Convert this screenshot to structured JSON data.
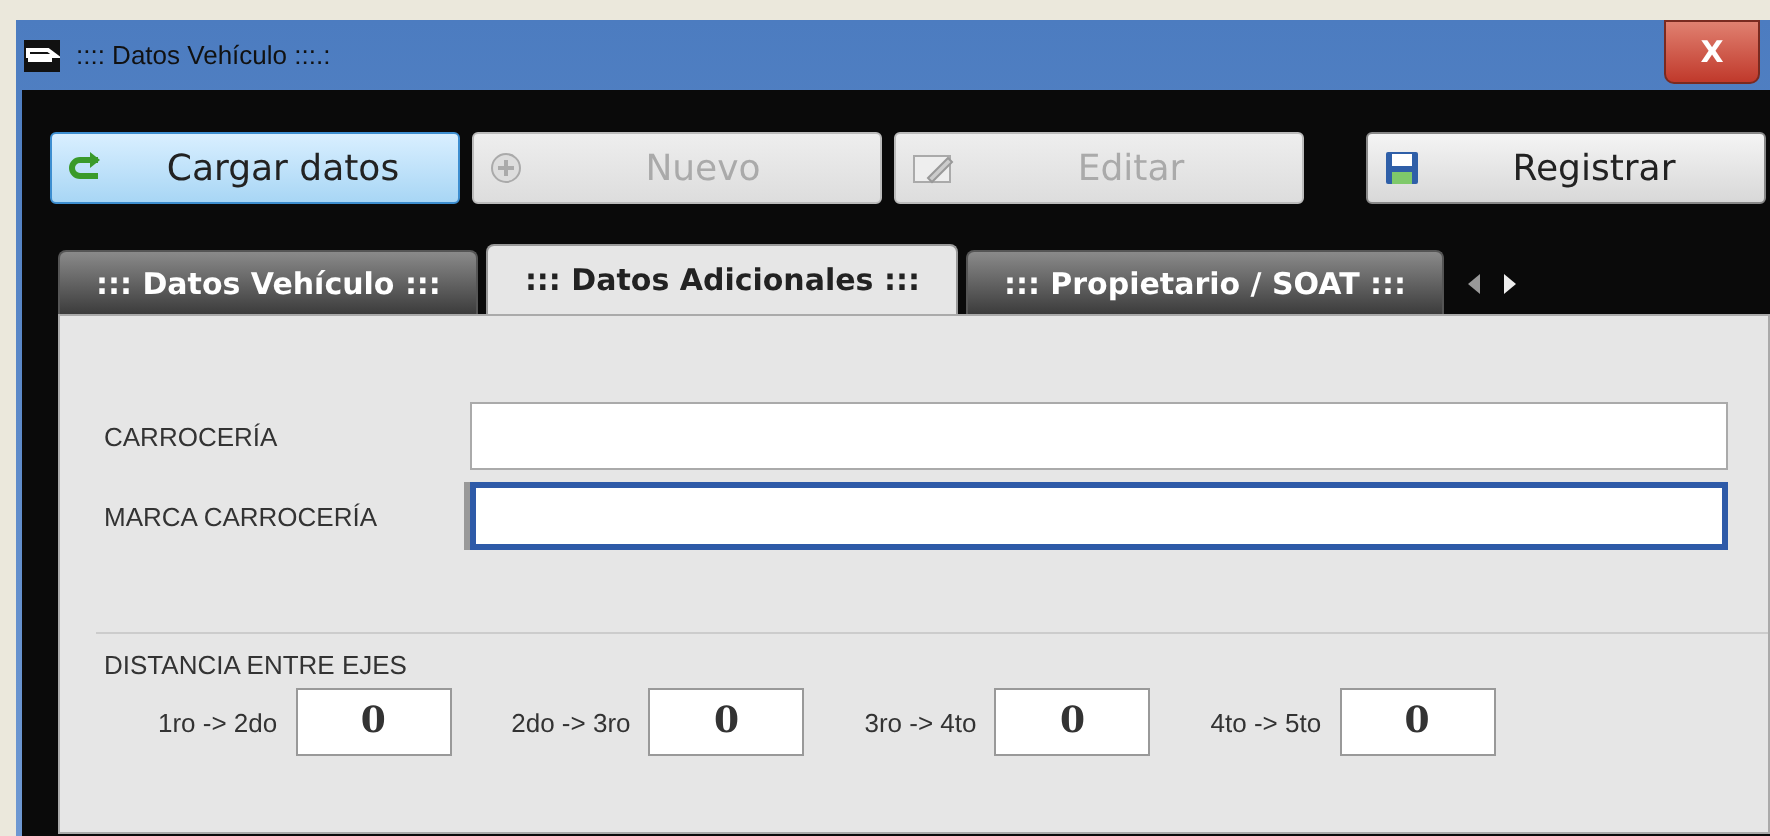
{
  "window": {
    "title": ":::: Datos Vehículo :::.:",
    "close": "X"
  },
  "toolbar": [
    {
      "label": "Cargar datos",
      "kind": "load",
      "active": true,
      "disabled": false
    },
    {
      "label": "Nuevo",
      "kind": "new",
      "active": false,
      "disabled": true
    },
    {
      "label": "Editar",
      "kind": "edit",
      "active": false,
      "disabled": true
    },
    {
      "label": "Registrar",
      "kind": "save",
      "active": false,
      "disabled": false
    }
  ],
  "tabs": [
    {
      "label": "::: Datos Vehículo :::",
      "selected": false
    },
    {
      "label": "::: Datos Adicionales :::",
      "selected": true
    },
    {
      "label": "::: Propietario / SOAT :::",
      "selected": false
    }
  ],
  "fields": [
    {
      "label": "CARROCERÍA",
      "focused": false
    },
    {
      "label": "MARCA CARROCERÍA",
      "focused": true
    }
  ],
  "axle_distance": {
    "title": "DISTANCIA ENTRE EJES",
    "items": [
      {
        "label": "1ro -> 2do",
        "value": "0"
      },
      {
        "label": "2do -> 3ro",
        "value": "0"
      },
      {
        "label": "3ro -> 4to",
        "value": "0"
      },
      {
        "label": "4to -> 5to",
        "value": "0"
      }
    ]
  }
}
